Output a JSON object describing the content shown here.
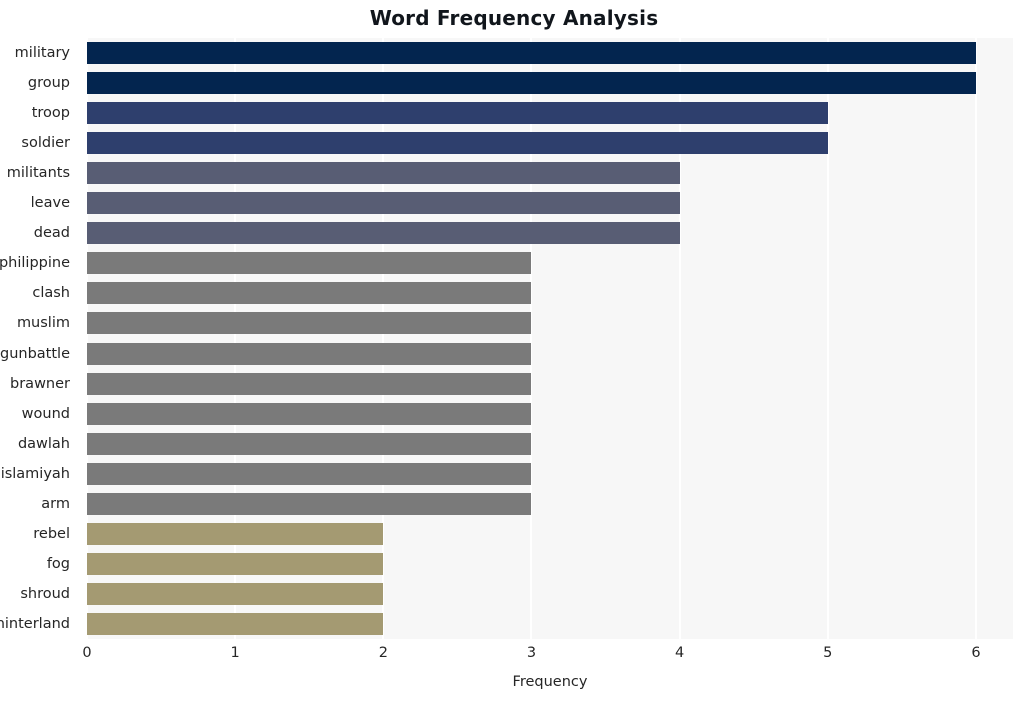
{
  "chart_data": {
    "type": "bar",
    "orientation": "horizontal",
    "title": "Word Frequency Analysis",
    "xlabel": "Frequency",
    "ylabel": "",
    "xlim": [
      0,
      6.25
    ],
    "xticks": [
      "0",
      "1",
      "2",
      "3",
      "4",
      "5",
      "6"
    ],
    "xtick_values": [
      0,
      1,
      2,
      3,
      4,
      5,
      6
    ],
    "grid": "vertical-white-on-light-gray",
    "legend": "none",
    "categories": [
      "military",
      "group",
      "troop",
      "soldier",
      "militants",
      "leave",
      "dead",
      "philippine",
      "clash",
      "muslim",
      "gunbattle",
      "brawner",
      "wound",
      "dawlah",
      "islamiyah",
      "arm",
      "rebel",
      "fog",
      "shroud",
      "hinterland"
    ],
    "values": [
      6,
      6,
      5,
      5,
      4,
      4,
      4,
      3,
      3,
      3,
      3,
      3,
      3,
      3,
      3,
      3,
      2,
      2,
      2,
      2
    ],
    "bar_colors": [
      "#03254f",
      "#03254f",
      "#2e3f6d",
      "#2e3f6d",
      "#585d74",
      "#585d74",
      "#585d74",
      "#7a7a7a",
      "#7a7a7a",
      "#7a7a7a",
      "#7a7a7a",
      "#7a7a7a",
      "#7a7a7a",
      "#7a7a7a",
      "#7a7a7a",
      "#7a7a7a",
      "#a49a72",
      "#a49a72",
      "#a49a72",
      "#a49a72"
    ]
  },
  "style": {
    "figure_background": "#ffffff",
    "plot_background": "#f7f7f7",
    "gridline_color": "#ffffff",
    "text_color": "#262626",
    "title_color": "#11161c"
  }
}
